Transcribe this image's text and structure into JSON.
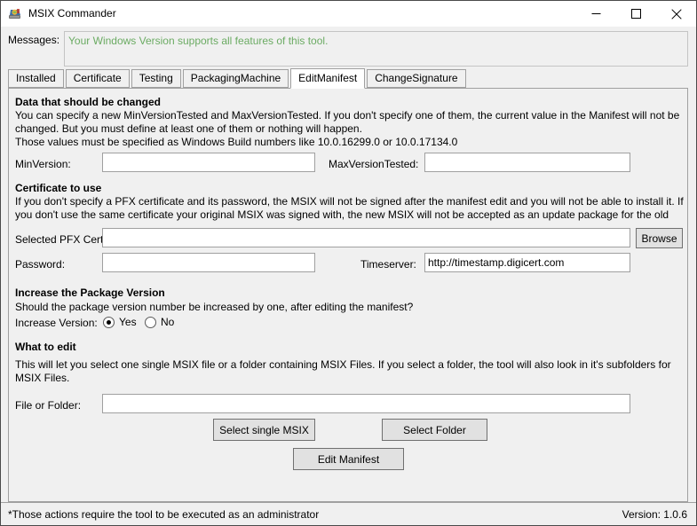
{
  "window": {
    "title": "MSIX Commander",
    "icon": "app-icon",
    "minimize_label": "Minimize",
    "maximize_label": "Maximize",
    "close_label": "Close"
  },
  "messages": {
    "label": "Messages:",
    "text": "Your Windows Version supports all features of this tool.",
    "text_color": "#6bab63"
  },
  "tabs": [
    {
      "label": "Installed",
      "active": false
    },
    {
      "label": "Certificate",
      "active": false
    },
    {
      "label": "Testing",
      "active": false
    },
    {
      "label": "PackagingMachine",
      "active": false
    },
    {
      "label": "EditManifest",
      "active": true
    },
    {
      "label": "ChangeSignature",
      "active": false
    }
  ],
  "edit_manifest": {
    "section_data": {
      "heading": "Data that should be changed",
      "para_line1": "You can specify a new MinVersionTested and MaxVersionTested. If you don't specify one of them, the current value in the Manifest will not be",
      "para_line2": "changed. But you must define at least one of them or nothing will happen.",
      "para_line3": "Those values must be specified as Windows Build numbers like 10.0.16299.0 or 10.0.17134.0",
      "minversion_label": "MinVersion:",
      "minversion_value": "",
      "maxversion_label": "MaxVersionTested:",
      "maxversion_value": ""
    },
    "section_cert": {
      "heading": "Certificate to use",
      "para_line1": "If you don't specify a PFX certificate and its password, the MSIX will not be signed after the manifest edit and you will not be able to install it. If",
      "para_line2": "you don't use the same certificate your original MSIX was signed with, the new MSIX will not be accepted as an update package for the old",
      "pfx_label": "Selected PFX Cert:",
      "pfx_value": "",
      "browse_label": "Browse",
      "password_label": "Password:",
      "password_value": "",
      "timeserver_label": "Timeserver:",
      "timeserver_value": "http://timestamp.digicert.com"
    },
    "section_version": {
      "heading": "Increase the Package Version",
      "para_line1": "Should the package version number be increased by one, after editing the manifest?",
      "increase_label": "Increase Version:",
      "option_yes": "Yes",
      "option_no": "No",
      "selected": "Yes"
    },
    "section_edit": {
      "heading": "What to edit",
      "para_line1": "This will let you select one single MSIX file or a folder containing MSIX Files. If you select a folder, the tool will also look in it's subfolders for",
      "para_line2": "MSIX Files.",
      "fileorfolder_label": "File or Folder:",
      "fileorfolder_value": "",
      "btn_select_single": "Select single MSIX",
      "btn_select_folder": "Select Folder",
      "btn_edit_manifest": "Edit Manifest"
    }
  },
  "statusbar": {
    "note": "*Those actions require the tool to be executed as an administrator",
    "version": "Version: 1.0.6"
  }
}
